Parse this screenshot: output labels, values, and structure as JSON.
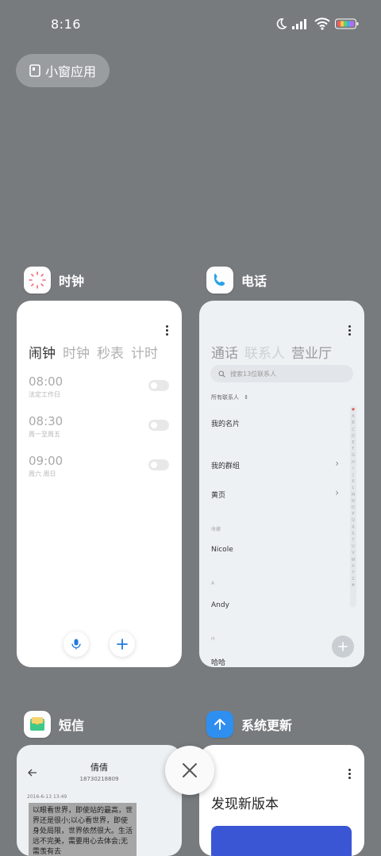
{
  "status_bar": {
    "time": "8:16"
  },
  "small_window": {
    "label": "小窗应用"
  },
  "apps": {
    "clock": {
      "name": "时钟",
      "tabs": [
        "闹钟",
        "时钟",
        "秒表",
        "计时"
      ],
      "alarms": [
        {
          "time": "08:00",
          "repeat": "法定工作日"
        },
        {
          "time": "08:30",
          "repeat": "周一至周五"
        },
        {
          "time": "09:00",
          "repeat": "周六 周日"
        }
      ]
    },
    "phone": {
      "name": "电话",
      "tabs": [
        "通话",
        "联系人",
        "营业厅"
      ],
      "search_placeholder": "搜索13位联系人",
      "filter_label": "所有联系人",
      "my_card": "我的名片",
      "my_groups": "我的群组",
      "yellow_pages": "黄页",
      "favorites_label": "收藏",
      "favorite_contact": "Nicole",
      "section_a": "A",
      "contact_a": "Andy",
      "section_h": "H",
      "contact_h": "哈哈",
      "index_letters": [
        "A",
        "B",
        "C",
        "D",
        "E",
        "F",
        "G",
        "H",
        "I",
        "J",
        "K",
        "L",
        "M",
        "N",
        "O",
        "P",
        "Q",
        "R",
        "S",
        "T",
        "U",
        "V",
        "W",
        "X",
        "Y",
        "Z",
        "#"
      ]
    },
    "sms": {
      "name": "短信",
      "contact_name": "倩倩",
      "contact_number": "18730218809",
      "timestamp": "2016-6-13 13:49",
      "message": "以眼看世界，即使站的最高，世界还是很小;以心看世界，即使身处局限，世界依然很大。生活远不完美，需要用心去体会;无需羡有去"
    },
    "update": {
      "name": "系统更新",
      "title": "发现新版本"
    }
  },
  "colors": {
    "background": "#787b7e",
    "accent": "#1e7be0",
    "phone_bg": "#eef1f4"
  }
}
